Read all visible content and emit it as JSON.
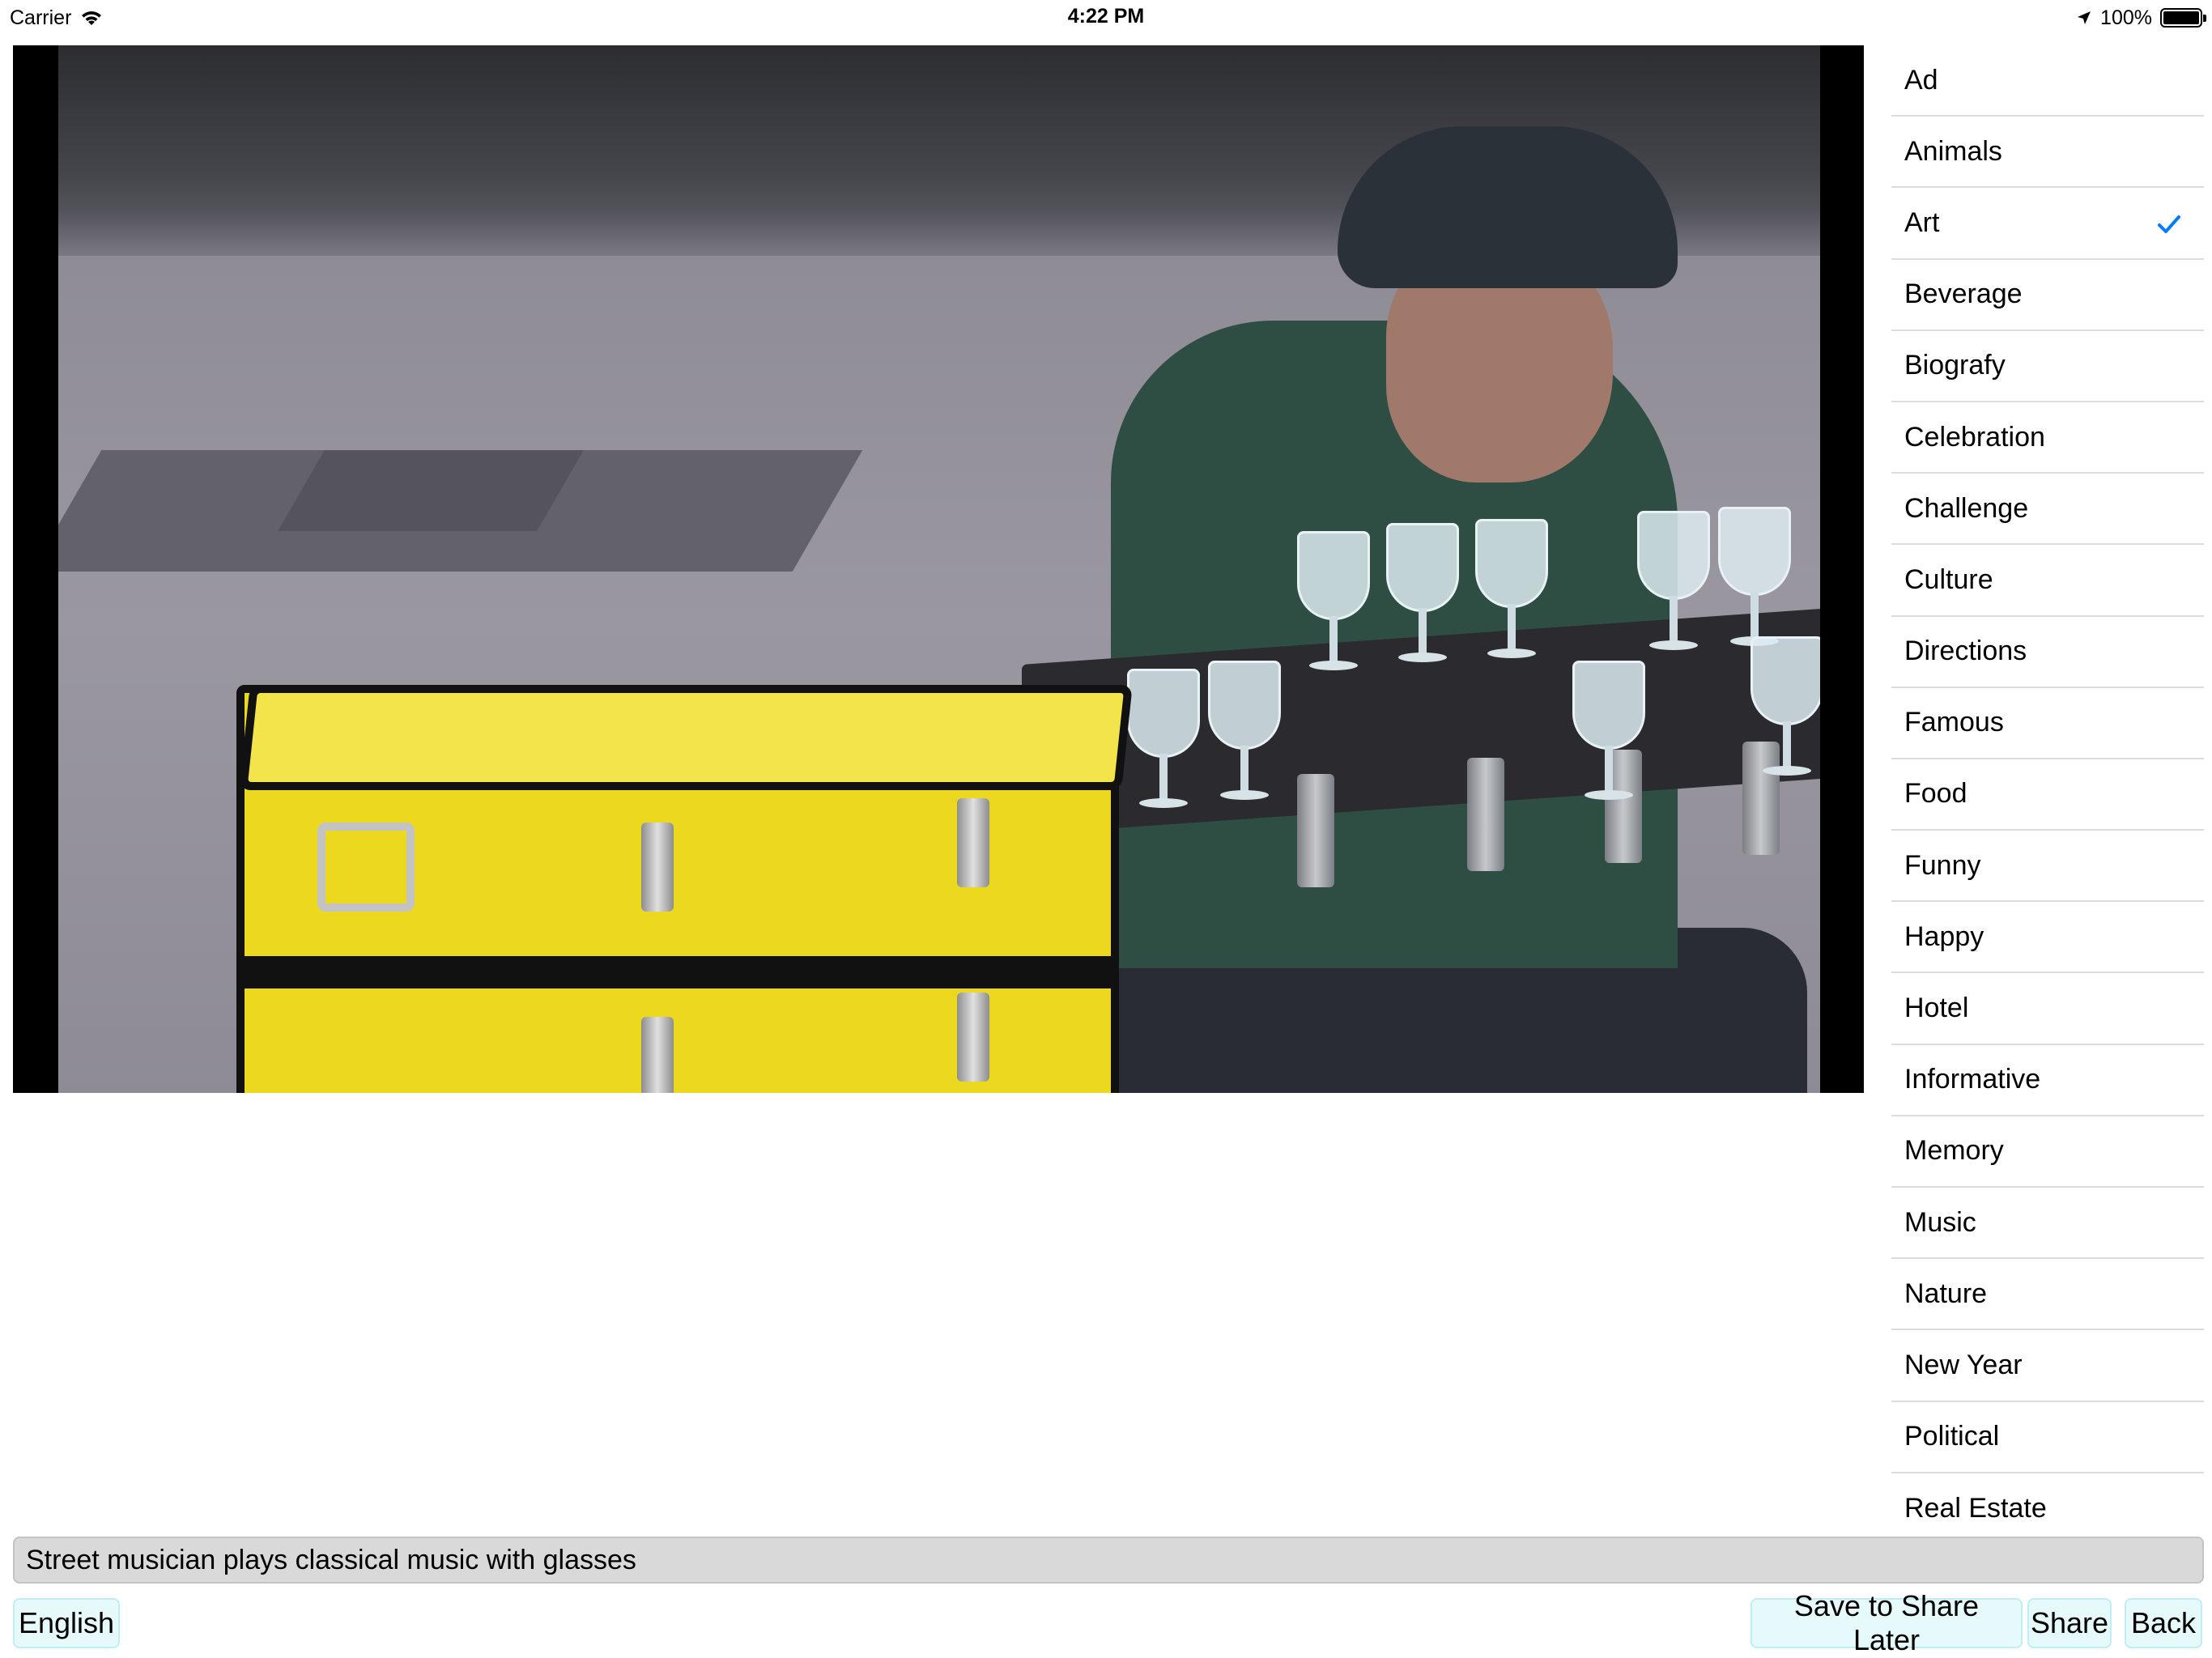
{
  "status_bar": {
    "carrier": "Carrier",
    "time": "4:22 PM",
    "battery_percent": "100%",
    "battery_level": 1.0,
    "icons": [
      "wifi-icon",
      "location-arrow-icon",
      "battery-icon"
    ]
  },
  "video": {
    "scene": "street-musician-playing-glass-harp"
  },
  "categories": {
    "items": [
      {
        "label": "Ad",
        "selected": false
      },
      {
        "label": "Animals",
        "selected": false
      },
      {
        "label": "Art",
        "selected": true
      },
      {
        "label": "Beverage",
        "selected": false
      },
      {
        "label": "Biografy",
        "selected": false
      },
      {
        "label": "Celebration",
        "selected": false
      },
      {
        "label": "Challenge",
        "selected": false
      },
      {
        "label": "Culture",
        "selected": false
      },
      {
        "label": "Directions",
        "selected": false
      },
      {
        "label": "Famous",
        "selected": false
      },
      {
        "label": "Food",
        "selected": false
      },
      {
        "label": "Funny",
        "selected": false
      },
      {
        "label": "Happy",
        "selected": false
      },
      {
        "label": "Hotel",
        "selected": false
      },
      {
        "label": "Informative",
        "selected": false
      },
      {
        "label": "Memory",
        "selected": false
      },
      {
        "label": "Music",
        "selected": false
      },
      {
        "label": "Nature",
        "selected": false
      },
      {
        "label": "New Year",
        "selected": false
      },
      {
        "label": "Political",
        "selected": false
      },
      {
        "label": "Real Estate",
        "selected": false
      }
    ],
    "check_icon": "checkmark-icon",
    "accent_color": "#007aff"
  },
  "description": {
    "text": "Street musician plays classical music with glasses"
  },
  "buttons": {
    "language": "English",
    "save_later": "Save to Share Later",
    "share": "Share",
    "back": "Back",
    "background_color": "#e6f9fb"
  }
}
